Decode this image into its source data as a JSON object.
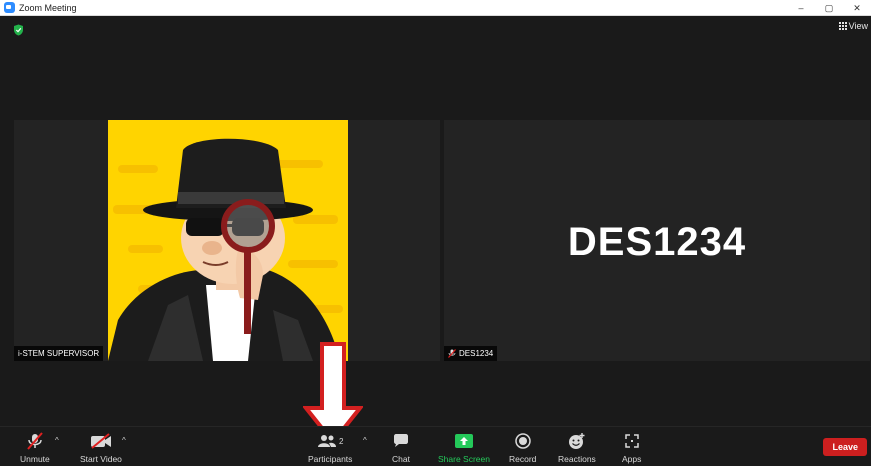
{
  "window": {
    "title": "Zoom Meeting",
    "minimize": "–",
    "restore": "▢",
    "close": "✕"
  },
  "header": {
    "view_label": "View"
  },
  "participants": [
    {
      "name": "i-STEM SUPERVISOR"
    },
    {
      "name": "DES1234",
      "display_text": "DES1234",
      "muted": true
    }
  ],
  "toolbar": {
    "unmute": "Unmute",
    "start_video": "Start Video",
    "participants": "Participants",
    "participants_count": "2",
    "chat": "Chat",
    "share_screen": "Share Screen",
    "record": "Record",
    "reactions": "Reactions",
    "apps": "Apps",
    "leave": "Leave"
  },
  "colors": {
    "share_green": "#24c95a",
    "leave_red": "#cc1f1f",
    "annotation_red": "#d32020",
    "avatar_yellow": "#ffd400"
  }
}
